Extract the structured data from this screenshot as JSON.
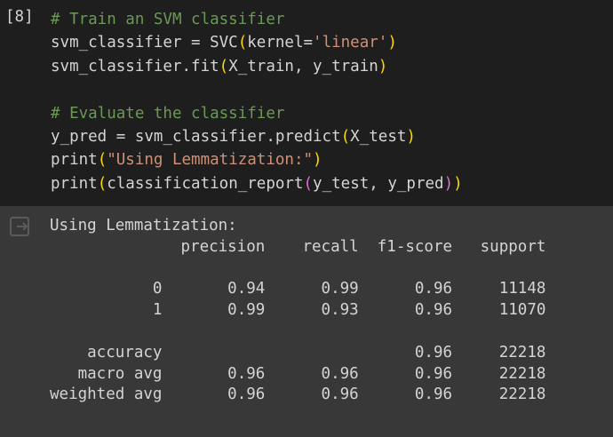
{
  "cell": {
    "execution_count": "[8]",
    "code_lines": [
      "# Train an SVM classifier",
      "svm_classifier = SVC(kernel='linear')",
      "svm_classifier.fit(X_train, y_train)",
      "",
      "# Evaluate the classifier",
      "y_pred = svm_classifier.predict(X_test)",
      "print(\"Using Lemmatization:\")",
      "print(classification_report(y_test, y_pred))"
    ]
  },
  "output": {
    "icon": "output-redirect-icon",
    "lines": [
      "Using Lemmatization:",
      "              precision    recall  f1-score   support",
      "",
      "           0       0.94      0.99      0.96     11148",
      "           1       0.99      0.93      0.96     11070",
      "",
      "    accuracy                           0.96     22218",
      "   macro avg       0.96      0.96      0.96     22218",
      "weighted avg       0.96      0.96      0.96     22218"
    ]
  },
  "colors": {
    "code_background": "#1e1e1e",
    "output_background": "#383838",
    "comment": "#6a9955",
    "string": "#ce9178",
    "bracket": "#ffd700",
    "bracket_nested": "#da70d6",
    "text": "#d4d4d4"
  }
}
